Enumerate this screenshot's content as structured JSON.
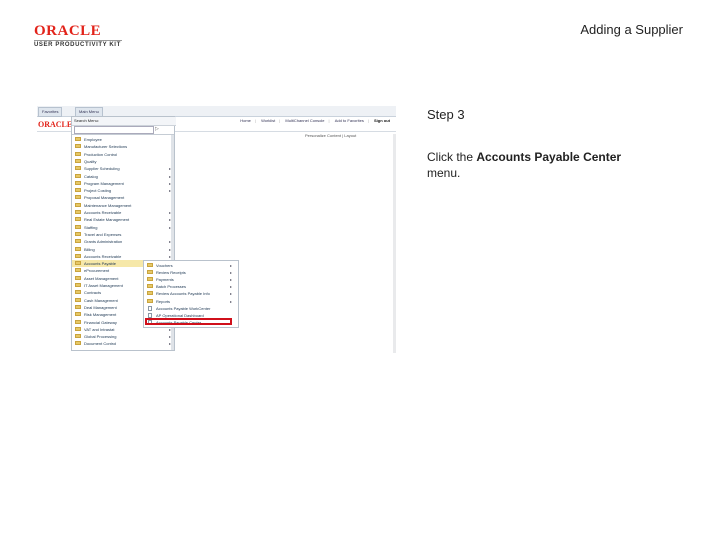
{
  "header": {
    "logo_oracle": "ORACLE",
    "logo_subtitle": "USER PRODUCTIVITY KIT",
    "doc_title": "Adding a Supplier"
  },
  "instructions": {
    "step": "Step 3",
    "text_before": "Click the ",
    "text_bold": "Accounts Payable Center",
    "text_after": " menu."
  },
  "screenshot": {
    "tabs": [
      "Favorites",
      "Main Menu"
    ],
    "brand": "ORACLE",
    "top_links": [
      "Home",
      "Worklist",
      "MultiChannel Console",
      "Add to Favorites",
      "Sign out"
    ],
    "customize": "Personalize Content | Layout",
    "menu_header": "Search Menu:",
    "menu_items": [
      {
        "label": "Employee",
        "arrow": false
      },
      {
        "label": "Manufacturer Selections",
        "arrow": false
      },
      {
        "label": "Production Control",
        "arrow": false
      },
      {
        "label": "Quality",
        "arrow": false
      },
      {
        "label": "Supplier Scheduling",
        "arrow": true
      },
      {
        "label": "Catalog",
        "arrow": true
      },
      {
        "label": "Program Management",
        "arrow": true
      },
      {
        "label": "Project Costing",
        "arrow": true
      },
      {
        "label": "Proposal Management",
        "arrow": false
      },
      {
        "label": "Maintenance Management",
        "arrow": false
      },
      {
        "label": "Accounts Receivable",
        "arrow": true
      },
      {
        "label": "Real Estate Management",
        "arrow": true
      },
      {
        "label": "Staffing",
        "arrow": true
      },
      {
        "label": "Travel and Expenses",
        "arrow": false
      },
      {
        "label": "Grants Administration",
        "arrow": true
      },
      {
        "label": "Billing",
        "arrow": true
      },
      {
        "label": "Accounts Receivable",
        "arrow": true
      },
      {
        "label": "Accounts Payable",
        "arrow": true,
        "highlight": true
      },
      {
        "label": "eProcurement",
        "arrow": true
      },
      {
        "label": "Asset Management",
        "arrow": true
      },
      {
        "label": "IT Asset Management",
        "arrow": true
      },
      {
        "label": "Contracts",
        "arrow": true
      },
      {
        "label": "Cash Management",
        "arrow": true
      },
      {
        "label": "Deal Management",
        "arrow": true
      },
      {
        "label": "Risk Management",
        "arrow": true
      },
      {
        "label": "Financial Gateway",
        "arrow": true
      },
      {
        "label": "VAT and Intrastat",
        "arrow": true
      },
      {
        "label": "Global Processing",
        "arrow": true
      },
      {
        "label": "Document Control",
        "arrow": true
      }
    ],
    "submenu_items": [
      {
        "label": "Vouchers",
        "kind": "folder",
        "arrow": true
      },
      {
        "label": "Review Receipts",
        "kind": "folder",
        "arrow": true
      },
      {
        "label": "Payments",
        "kind": "folder",
        "arrow": true
      },
      {
        "label": "Batch Processes",
        "kind": "folder",
        "arrow": true
      },
      {
        "label": "Review Accounts Payable Info",
        "kind": "folder",
        "arrow": true
      },
      {
        "label": "Reports",
        "kind": "folder",
        "arrow": true
      },
      {
        "label": "Accounts Payable WorkCenter",
        "kind": "page",
        "arrow": false
      },
      {
        "label": "AP Operational Dashboard",
        "kind": "page",
        "arrow": false
      },
      {
        "label": "Accounts Payable Center",
        "kind": "page",
        "arrow": false
      }
    ]
  }
}
